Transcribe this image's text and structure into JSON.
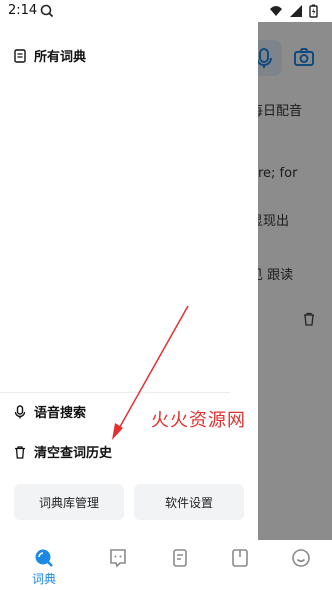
{
  "status_bar": {
    "time": "2:14"
  },
  "drawer": {
    "all_dicts": "所有词典",
    "voice_search": "语音搜索",
    "clear_history": "清空查词历史",
    "dict_manage_button": "词典库管理",
    "settings_button": "软件设置"
  },
  "background": {
    "daily_audio": "每日配音",
    "snippet_1": "are; for",
    "snippet_2": "显现出",
    "snippet_3": "见  跟读"
  },
  "watermark": "火火资源网",
  "bottom_nav": {
    "active_label": "词典"
  },
  "colors": {
    "accent": "#1e88e5",
    "watermark": "#e53030",
    "overlay": "#737373"
  }
}
